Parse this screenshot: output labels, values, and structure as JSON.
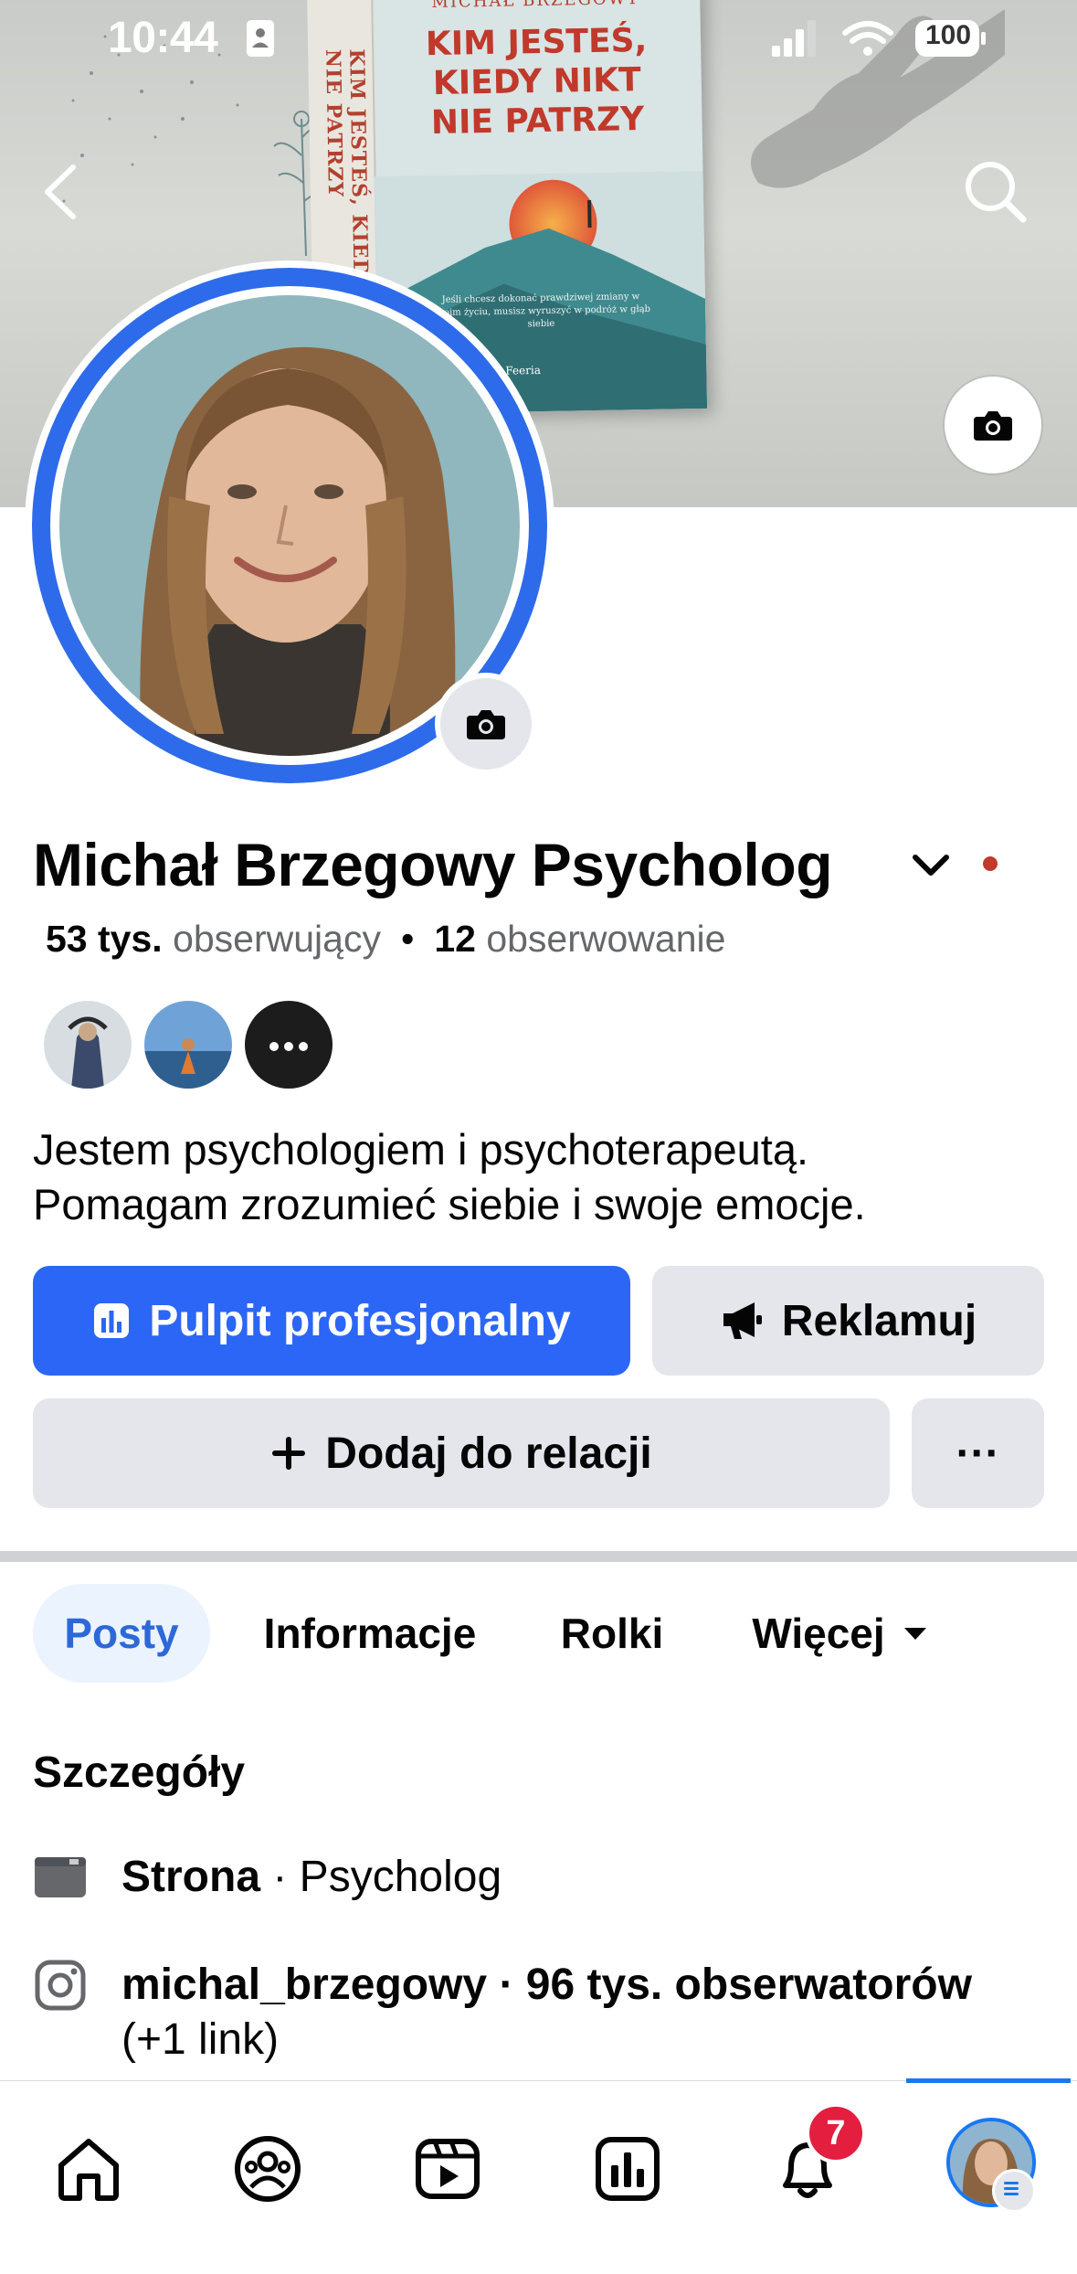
{
  "status_bar": {
    "time": "10:44",
    "battery": "100"
  },
  "cover": {
    "book_author": "MICHAŁ BRZEGOWY",
    "book_title_lines": [
      "KIM JESTEŚ,",
      "KIEDY NIKT",
      "NIE PATRZY"
    ],
    "book_spine": "KIM JESTEŚ, KIEDY NIKT NIE PATRZY",
    "book_blurb": "Jeśli chcesz dokonać prawdziwej zmiany w swoim życiu, musisz wyruszyć w podróż w głąb siebie",
    "book_publisher": "Feeria"
  },
  "profile": {
    "name": "Michał Brzegowy Psycholog",
    "followers_count": "53 tys.",
    "followers_label": "obserwujący",
    "following_count": "12",
    "following_label": "obserwowanie",
    "bio_line1": "Jestem psychologiem i psychoterapeutą.",
    "bio_line2": "Pomagam zrozumieć siebie i swoje emocje."
  },
  "buttons": {
    "dashboard": "Pulpit profesjonalny",
    "advertise": "Reklamuj",
    "add_story": "Dodaj do relacji",
    "more": "···"
  },
  "tabs": [
    {
      "label": "Posty"
    },
    {
      "label": "Informacje"
    },
    {
      "label": "Rolki"
    },
    {
      "label": "Więcej"
    }
  ],
  "details": {
    "title": "Szczegóły",
    "page_strong": "Strona",
    "page_rest": " · Psycholog",
    "instagram_strong": "michal_brzegowy · 96 tys. obserwatorów",
    "instagram_rest": "(+1 link)"
  },
  "bottom_nav": {
    "notifications_badge": "7"
  },
  "colors": {
    "primary": "#2b66f6",
    "badge": "#e41e3f",
    "active_tab_bg": "#ebf3ff",
    "active_tab_text": "#2e68d8"
  }
}
